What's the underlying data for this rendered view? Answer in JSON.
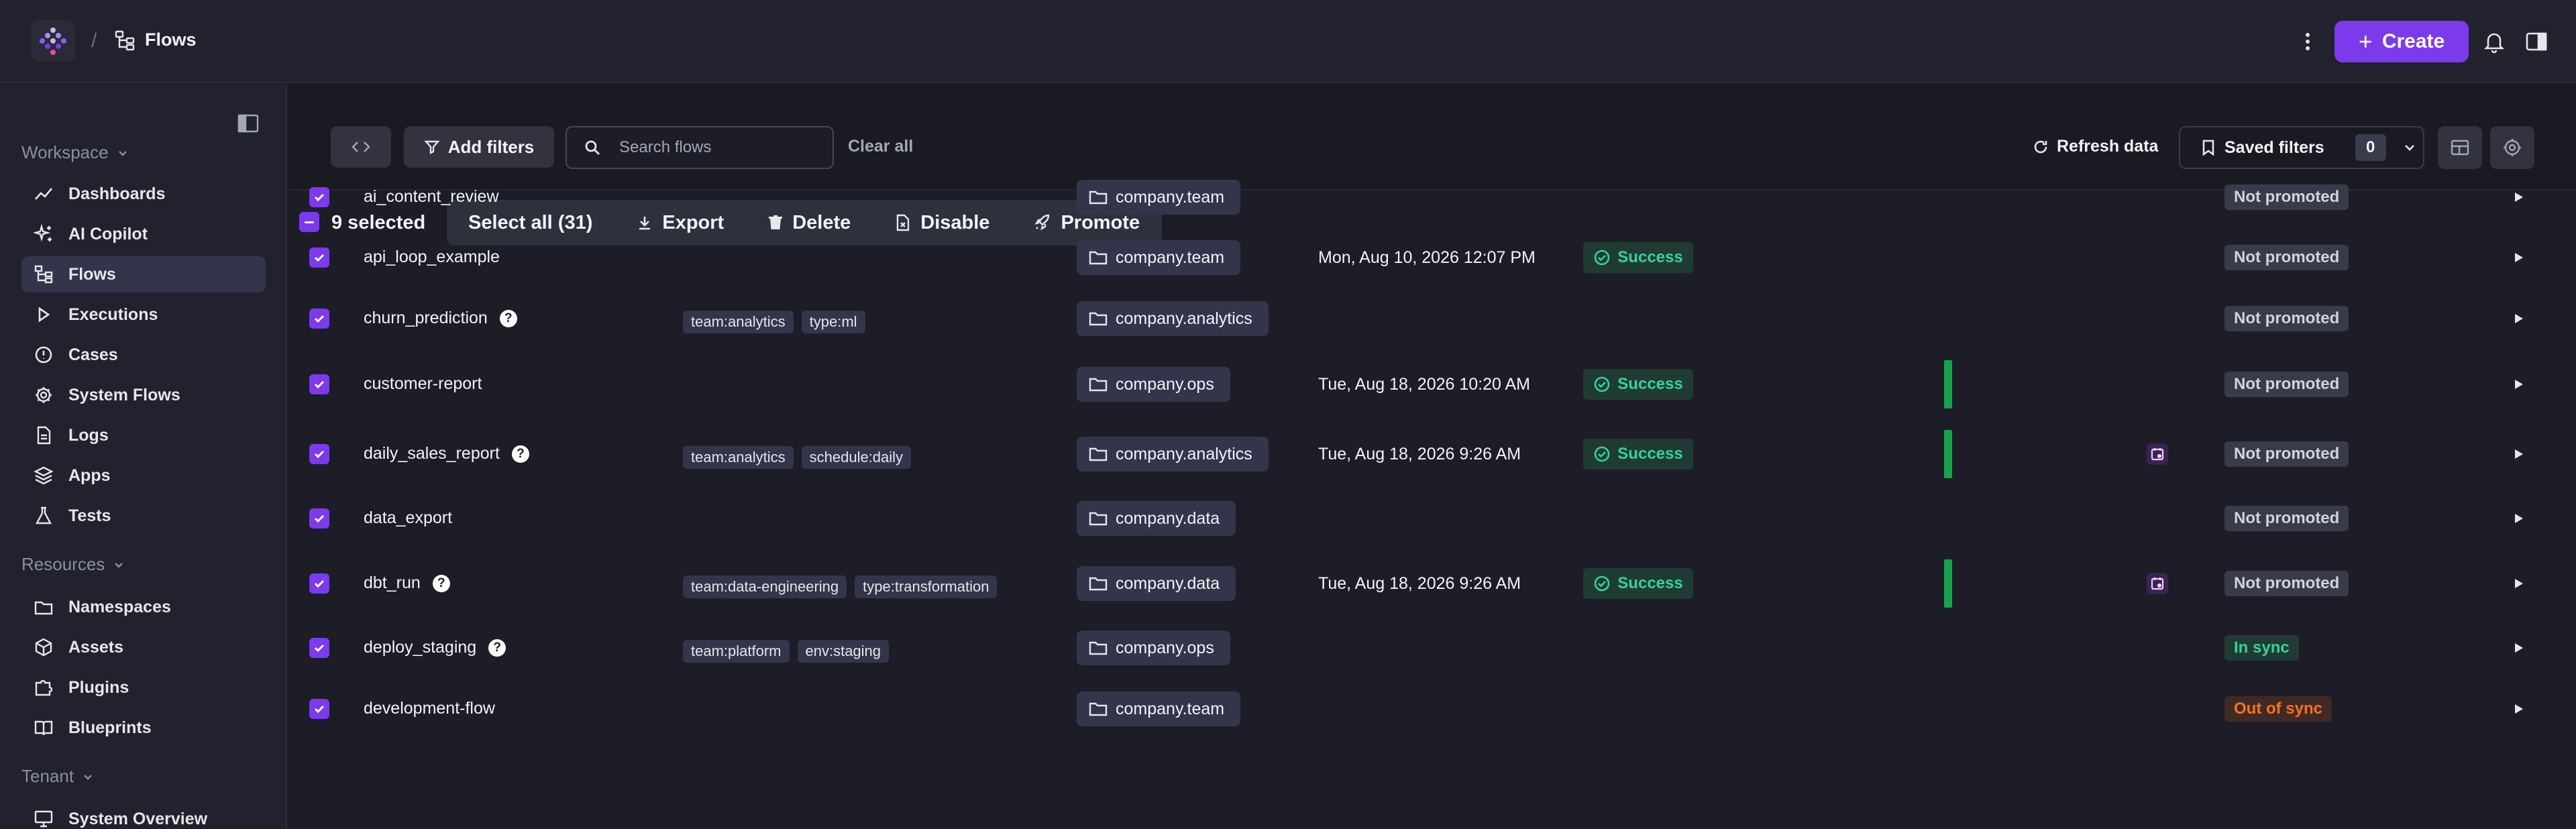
{
  "header": {
    "separator": "/",
    "page_title": "Flows",
    "create_label": "Create"
  },
  "sidebar": {
    "sections": [
      {
        "label": "Workspace"
      },
      {
        "label": "Resources"
      },
      {
        "label": "Tenant"
      }
    ],
    "items": [
      {
        "label": "Dashboards",
        "icon": "chart-line-icon"
      },
      {
        "label": "AI Copilot",
        "icon": "sparkle-icon"
      },
      {
        "label": "Flows",
        "icon": "flow-icon",
        "active": true
      },
      {
        "label": "Executions",
        "icon": "play-icon"
      },
      {
        "label": "Cases",
        "icon": "alert-circle-icon"
      },
      {
        "label": "System Flows",
        "icon": "gear-icon"
      },
      {
        "label": "Logs",
        "icon": "file-icon"
      },
      {
        "label": "Apps",
        "icon": "layers-icon"
      },
      {
        "label": "Tests",
        "icon": "flask-icon"
      },
      {
        "label": "Namespaces",
        "icon": "folder-icon"
      },
      {
        "label": "Assets",
        "icon": "cube-icon"
      },
      {
        "label": "Plugins",
        "icon": "puzzle-icon"
      },
      {
        "label": "Blueprints",
        "icon": "book-icon"
      },
      {
        "label": "System Overview",
        "icon": "monitor-icon"
      }
    ]
  },
  "filters": {
    "add_filters_label": "Add filters",
    "search_placeholder": "Search flows",
    "clear_all_label": "Clear all",
    "refresh_label": "Refresh data",
    "saved_filters_label": "Saved filters",
    "saved_filters_count": "0"
  },
  "bulk": {
    "selected_label": "9 selected",
    "select_all_label": "Select all (31)",
    "export_label": "Export",
    "delete_label": "Delete",
    "disable_label": "Disable",
    "promote_label": "Promote"
  },
  "rows": [
    {
      "name": "ai_content_review",
      "help": false,
      "labels": [],
      "namespace": "company.team",
      "date": "",
      "status": "",
      "bar": false,
      "trigger": false,
      "promotion": "Not promoted",
      "promo_type": "np"
    },
    {
      "name": "api_loop_example",
      "help": false,
      "labels": [],
      "namespace": "company.team",
      "date": "Mon, Aug 10, 2026 12:07 PM",
      "status": "Success",
      "bar": false,
      "trigger": false,
      "promotion": "Not promoted",
      "promo_type": "np"
    },
    {
      "name": "churn_prediction",
      "help": true,
      "labels": [
        "team:analytics",
        "type:ml"
      ],
      "namespace": "company.analytics",
      "date": "",
      "status": "",
      "bar": false,
      "trigger": false,
      "promotion": "Not promoted",
      "promo_type": "np"
    },
    {
      "name": "customer-report",
      "help": false,
      "labels": [],
      "namespace": "company.ops",
      "date": "Tue, Aug 18, 2026 10:20 AM",
      "status": "Success",
      "bar": true,
      "trigger": false,
      "promotion": "Not promoted",
      "promo_type": "np"
    },
    {
      "name": "daily_sales_report",
      "help": true,
      "labels": [
        "team:analytics",
        "schedule:daily"
      ],
      "namespace": "company.analytics",
      "date": "Tue, Aug 18, 2026 9:26 AM",
      "status": "Success",
      "bar": true,
      "trigger": true,
      "promotion": "Not promoted",
      "promo_type": "np"
    },
    {
      "name": "data_export",
      "help": false,
      "labels": [],
      "namespace": "company.data",
      "date": "",
      "status": "",
      "bar": false,
      "trigger": false,
      "promotion": "Not promoted",
      "promo_type": "np"
    },
    {
      "name": "dbt_run",
      "help": true,
      "labels": [
        "team:data-engineering",
        "type:transformation"
      ],
      "namespace": "company.data",
      "date": "Tue, Aug 18, 2026 9:26 AM",
      "status": "Success",
      "bar": true,
      "trigger": true,
      "promotion": "Not promoted",
      "promo_type": "np"
    },
    {
      "name": "deploy_staging",
      "help": true,
      "labels": [
        "team:platform",
        "env:staging"
      ],
      "namespace": "company.ops",
      "date": "",
      "status": "",
      "bar": false,
      "trigger": false,
      "promotion": "In sync",
      "promo_type": "sync"
    },
    {
      "name": "development-flow",
      "help": false,
      "labels": [],
      "namespace": "company.team",
      "date": "",
      "status": "",
      "bar": false,
      "trigger": false,
      "promotion": "Out of sync",
      "promo_type": "oos"
    }
  ],
  "colors": {
    "accent": "#7c3aed",
    "success": "#34d399",
    "warning": "#f97316"
  }
}
